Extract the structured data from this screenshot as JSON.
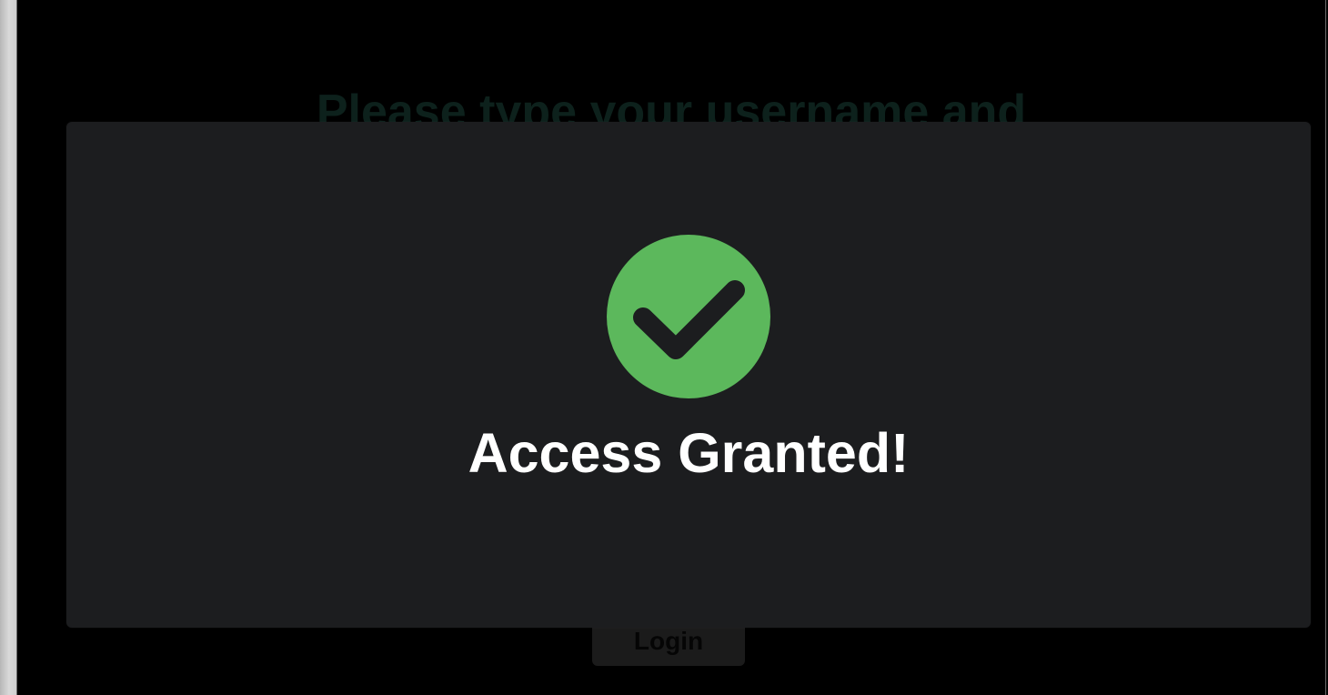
{
  "login": {
    "title": "Please type your username and",
    "button_label": "Login"
  },
  "dialog": {
    "message": "Access Granted!",
    "icon": "check-circle-icon",
    "accent_color": "#5CB85C",
    "background_color": "#1C1D1F"
  }
}
